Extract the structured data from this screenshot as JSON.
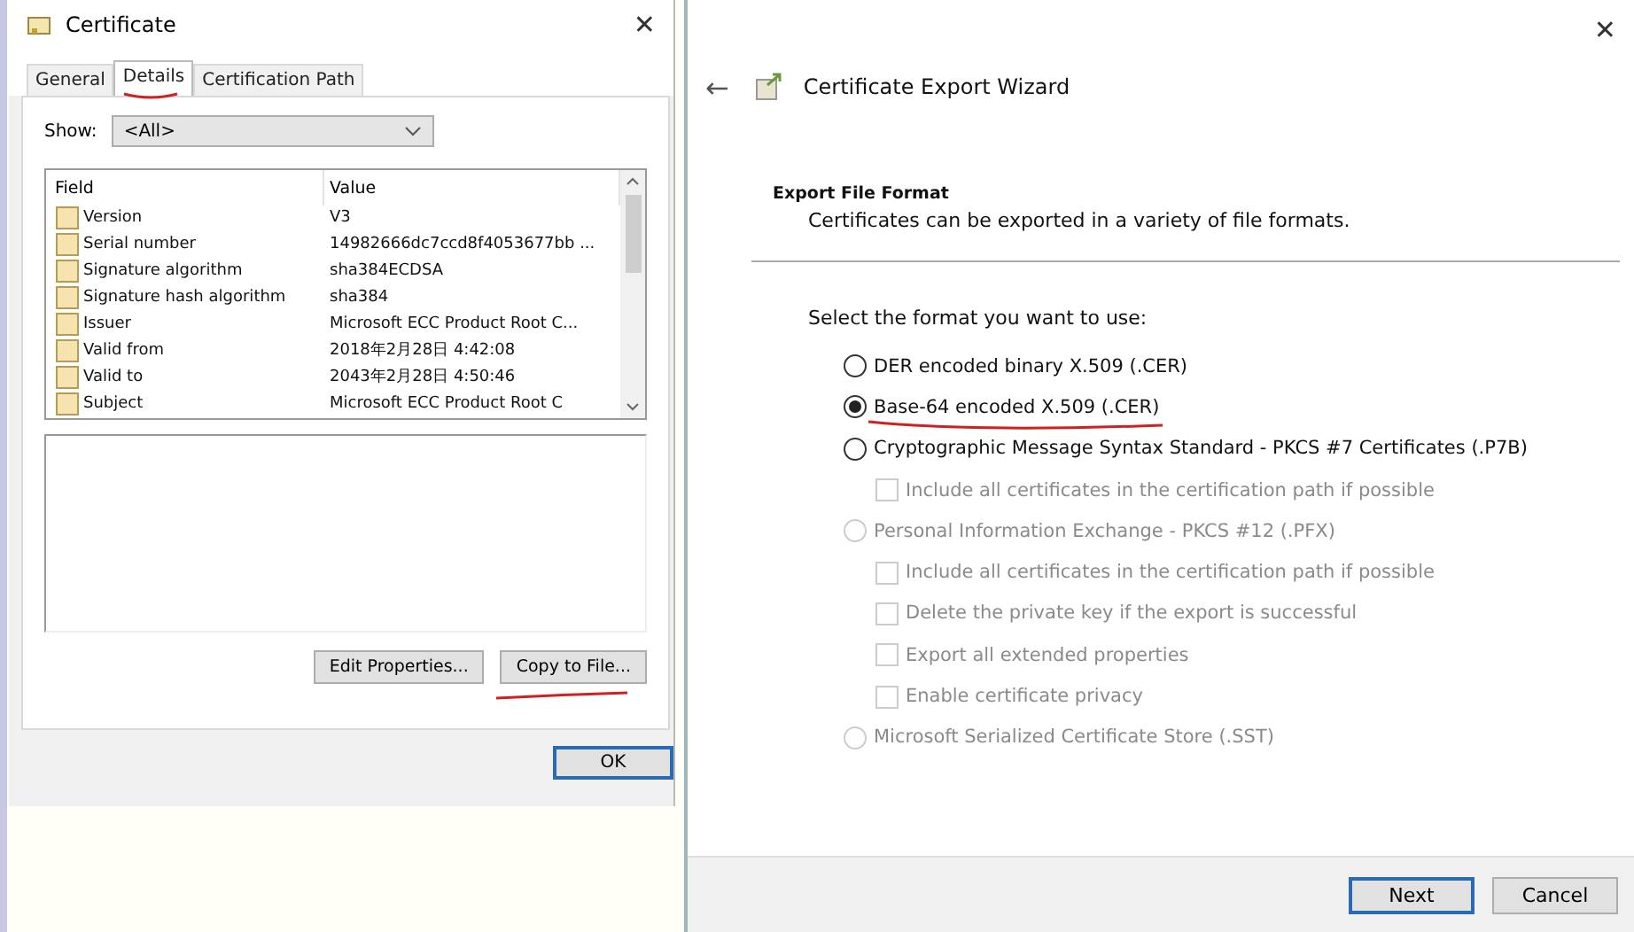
{
  "certificate_dialog": {
    "title": "Certificate",
    "close": "✕",
    "tabs": [
      {
        "label": "General",
        "selected": false
      },
      {
        "label": "Details",
        "selected": true
      },
      {
        "label": "Certification Path",
        "selected": false
      }
    ],
    "show": {
      "label": "Show:",
      "value": "<All>"
    },
    "table": {
      "columns": [
        "Field",
        "Value"
      ],
      "rows": [
        {
          "field": "Version",
          "value": "V3"
        },
        {
          "field": "Serial number",
          "value": "14982666dc7ccd8f4053677bb ..."
        },
        {
          "field": "Signature algorithm",
          "value": "sha384ECDSA"
        },
        {
          "field": "Signature hash algorithm",
          "value": "sha384"
        },
        {
          "field": "Issuer",
          "value": "Microsoft ECC Product Root C..."
        },
        {
          "field": "Valid from",
          "value": "2018年2月28日 4:42:08"
        },
        {
          "field": "Valid to",
          "value": "2043年2月28日 4:50:46"
        },
        {
          "field": "Subject",
          "value": "Microsoft ECC Product Root C"
        }
      ]
    },
    "buttons": [
      "Edit Properties...",
      "Copy to File..."
    ],
    "ok": "OK"
  },
  "export_wizard": {
    "close": "✕",
    "back": "←",
    "title": "Certificate Export Wizard",
    "heading": "Export File Format",
    "description": "Certificates can be exported in a variety of file formats.",
    "prompt": "Select the format you want to use:",
    "formats": [
      {
        "label": "DER encoded binary X.509 (.CER)",
        "selected": false,
        "disabled": false
      },
      {
        "label": "Base-64 encoded X.509 (.CER)",
        "selected": true,
        "disabled": false
      },
      {
        "label": "Cryptographic Message Syntax Standard - PKCS #7 Certificates (.P7B)",
        "selected": false,
        "disabled": false,
        "options": [
          {
            "label": "Include all certificates in the certification path if possible",
            "checked": false,
            "disabled": true
          }
        ]
      },
      {
        "label": "Personal Information Exchange - PKCS #12 (.PFX)",
        "selected": false,
        "disabled": true,
        "options": [
          {
            "label": "Include all certificates in the certification path if possible",
            "checked": false,
            "disabled": true
          },
          {
            "label": "Delete the private key if the export is successful",
            "checked": false,
            "disabled": true
          },
          {
            "label": "Export all extended properties",
            "checked": false,
            "disabled": true
          },
          {
            "label": "Enable certificate privacy",
            "checked": false,
            "disabled": true
          }
        ]
      },
      {
        "label": "Microsoft Serialized Certificate Store (.SST)",
        "selected": false,
        "disabled": true
      }
    ],
    "buttons": [
      {
        "label": "Next",
        "default": true
      },
      {
        "label": "Cancel",
        "default": false
      }
    ]
  }
}
